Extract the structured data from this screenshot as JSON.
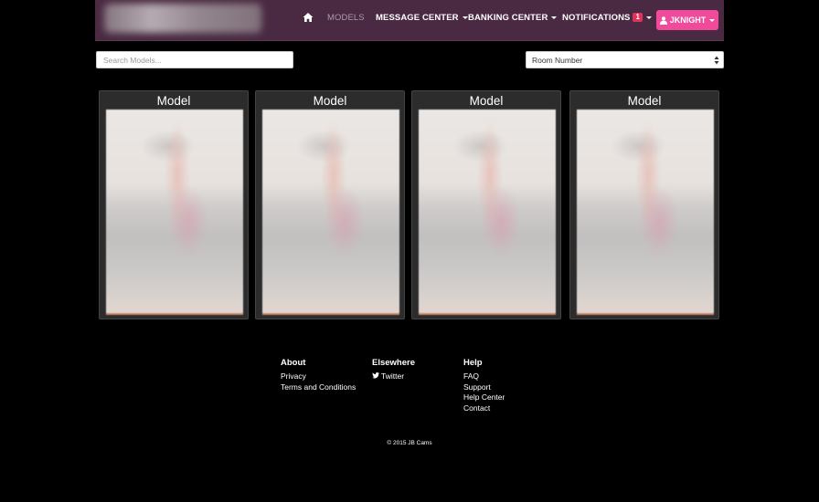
{
  "nav": {
    "home_icon": "home-icon",
    "models": "MODELS",
    "message_center": "MESSAGE CENTER",
    "banking_center": "BANKING CENTER",
    "notifications": "NOTIFICATIONS",
    "notifications_count": "1",
    "user": "JKNIGHT",
    "user_icon": "user-icon",
    "bar_color": "#4a2a42",
    "user_button_color": "#f04b9b"
  },
  "search": {
    "placeholder": "Search Models..."
  },
  "sort": {
    "selected": "Room Number"
  },
  "models": [
    {
      "title": "Model"
    },
    {
      "title": "Model"
    },
    {
      "title": "Model"
    },
    {
      "title": "Model"
    }
  ],
  "footer": {
    "about": {
      "heading": "About",
      "links": [
        "Privacy",
        "Terms and Conditions"
      ]
    },
    "elsewhere": {
      "heading": "Elsewhere",
      "links": [
        "Twitter"
      ],
      "icon": "twitter-icon"
    },
    "help": {
      "heading": "Help",
      "links": [
        "FAQ",
        "Support",
        "Help Center",
        "Contact"
      ]
    },
    "copyright": "© 2015 JB Cams"
  }
}
